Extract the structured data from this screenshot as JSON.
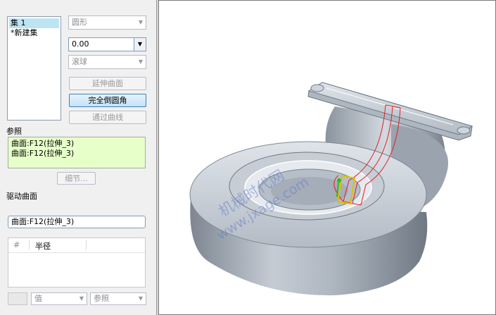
{
  "sets": {
    "items": [
      "集 1",
      "*新建集"
    ],
    "selected_index": 0
  },
  "shape_select": {
    "value": "圆形"
  },
  "value_input": {
    "value": "0.00"
  },
  "method_select": {
    "value": "滚球"
  },
  "buttons": {
    "extend_surface": "延伸曲面",
    "full_round": "完全倒圆角",
    "through_curve": "通过曲线",
    "details": "细节..."
  },
  "references": {
    "label": "参照",
    "items": [
      "曲面:F12(拉伸_3)",
      "曲面:F12(拉伸_3)"
    ]
  },
  "drive_surface": {
    "label": "驱动曲面",
    "value": "曲面:F12(拉伸_3)"
  },
  "radius_table": {
    "col_num": "#",
    "col_radius": "半径"
  },
  "bottom": {
    "value_select": "值",
    "ref_select": "参照"
  },
  "viewport": {
    "watermark_line1": "机械时代网",
    "watermark_line2": "www.jxage.com",
    "colors": {
      "model_body": "#aeb6c0",
      "model_dark": "#6f7883",
      "model_light": "#dfe4ea",
      "highlight": "#e02020",
      "selection": "#e0c000",
      "handle": "#20c020",
      "watermark": "#5a78c8"
    }
  }
}
